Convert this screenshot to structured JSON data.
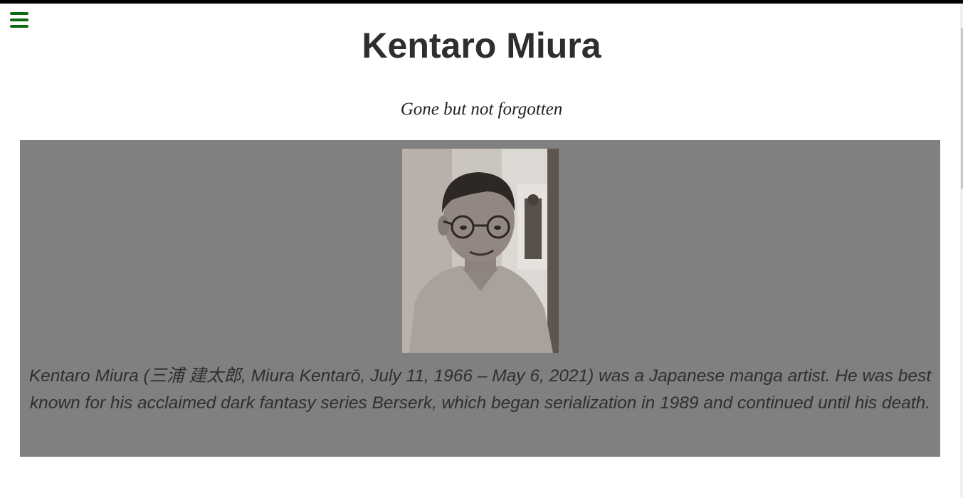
{
  "header": {
    "menu_icon": "hamburger-menu-icon",
    "menu_color": "#0f6a0f",
    "title": "Kentaro Miura",
    "tagline": "Gone but not forgotten"
  },
  "tribute": {
    "panel_color": "#808080",
    "bio": "Kentaro Miura (三浦 建太郎, Miura Kentarō, July 11, 1966 – May 6, 2021) was a Japanese manga artist. He was best known for his acclaimed dark fantasy series Berserk, which began serialization in 1989 and continued until his death."
  }
}
